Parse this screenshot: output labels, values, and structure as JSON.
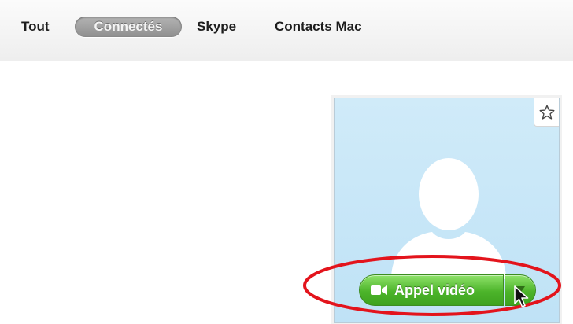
{
  "filters": {
    "tabs": [
      {
        "label": "Tout",
        "selected": false
      },
      {
        "label": "Connectés",
        "selected": true
      },
      {
        "label": "Skype",
        "selected": false
      },
      {
        "label": "Contacts Mac",
        "selected": false
      }
    ]
  },
  "contact_card": {
    "favorite_icon": "star-outline-icon",
    "avatar_icon": "default-person-avatar-icon",
    "background_color": "#c8e7f8",
    "call_button": {
      "label": "Appel vidéo",
      "icon": "video-camera-icon",
      "color": "#4cb42a"
    },
    "call_options_icon": "triangle-down-icon"
  },
  "annotation": {
    "shape": "ellipse",
    "color": "#e3141c"
  }
}
